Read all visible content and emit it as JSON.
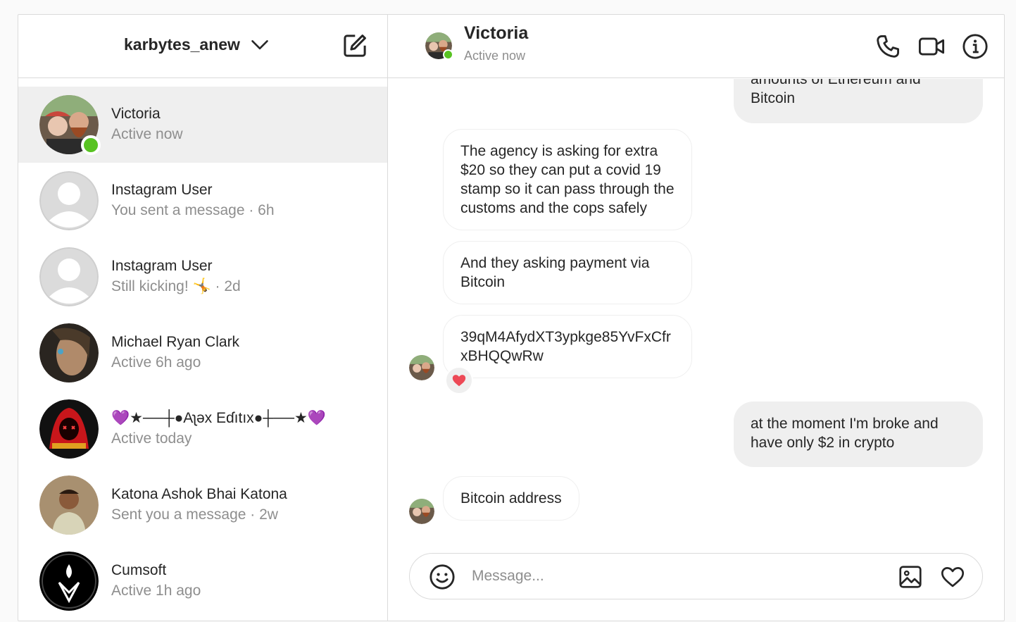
{
  "account": {
    "username": "karbytes_anew",
    "switcher_icon": "chevron-down-icon",
    "compose_icon": "new-message-icon"
  },
  "threads": [
    {
      "name": "Victoria",
      "status": "Active now",
      "online": true,
      "active": true
    },
    {
      "name": "Instagram User",
      "status": "You sent a message · 6h"
    },
    {
      "name": "Instagram User",
      "status": "Still kicking! 🤸 · 2d"
    },
    {
      "name": "Michael Ryan Clark",
      "status": "Active 6h ago"
    },
    {
      "name": "💜★──┼●Aʅəx Eɗıtıx●┼──★💜",
      "status": "Active today"
    },
    {
      "name": "Katona Ashok Bhai Katona",
      "status": "Sent you a message · 2w"
    },
    {
      "name": "Cumsoft",
      "status": "Active 1h ago"
    }
  ],
  "conversation": {
    "name": "Victoria",
    "status": "Active now",
    "actions": [
      "phone-icon",
      "video-call-icon",
      "info-icon"
    ],
    "messages": [
      {
        "from": "me",
        "text": "amounts of Ethereum and Bitcoin"
      },
      {
        "from": "them",
        "text": "The agency is asking for extra $20 so they can put a covid 19 stamp so it can pass through the customs and the cops safely"
      },
      {
        "from": "them",
        "text": "And they asking payment via Bitcoin"
      },
      {
        "from": "them",
        "text": "39qM4AfydXT3ypkge85YvFxCfrxBHQQwRw",
        "reaction": "heart"
      },
      {
        "from": "me",
        "text": "at the moment I'm broke and have only $2 in crypto"
      },
      {
        "from": "them",
        "text": "Bitcoin address"
      }
    ]
  },
  "composer": {
    "placeholder": "Message...",
    "icons": [
      "emoji-icon",
      "image-icon",
      "heart-icon"
    ]
  },
  "colors": {
    "online": "#58c322",
    "heart": "#ed4956",
    "border": "#dbdbdb",
    "bubble_out": "#efefef",
    "muted": "#8e8e8e"
  }
}
